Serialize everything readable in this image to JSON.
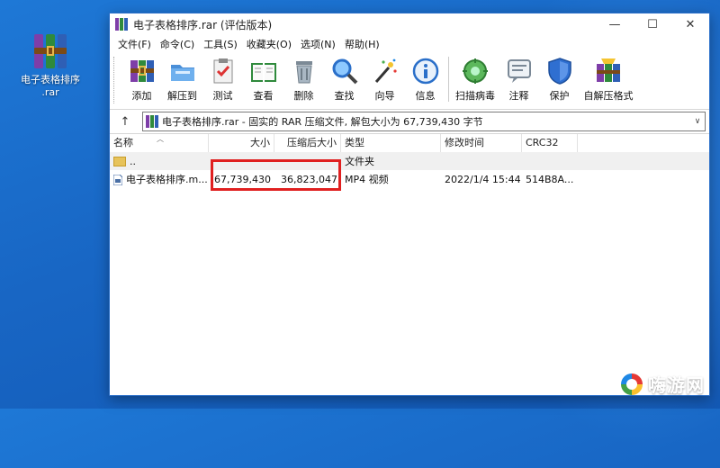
{
  "desktop": {
    "icon_label": "电子表格排序\n.rar"
  },
  "window": {
    "title": "电子表格排序.rar (评估版本)",
    "controls": {
      "minimize": "—",
      "maximize": "☐",
      "close": "✕"
    }
  },
  "menu": [
    "文件(F)",
    "命令(C)",
    "工具(S)",
    "收藏夹(O)",
    "选项(N)",
    "帮助(H)"
  ],
  "toolbar": [
    {
      "label": "添加",
      "icon": "add-books-icon"
    },
    {
      "label": "解压到",
      "icon": "extract-folder-icon"
    },
    {
      "label": "测试",
      "icon": "test-clipboard-icon"
    },
    {
      "label": "查看",
      "icon": "view-book-icon"
    },
    {
      "label": "删除",
      "icon": "trash-icon"
    },
    {
      "label": "查找",
      "icon": "magnifier-icon"
    },
    {
      "label": "向导",
      "icon": "wizard-wand-icon"
    },
    {
      "label": "信息",
      "icon": "info-icon"
    },
    {
      "label": "扫描病毒",
      "icon": "virus-scan-icon"
    },
    {
      "label": "注释",
      "icon": "comment-icon"
    },
    {
      "label": "保护",
      "icon": "shield-icon"
    },
    {
      "label": "自解压格式",
      "icon": "sfx-books-icon"
    }
  ],
  "address": {
    "up": "↑",
    "text": "电子表格排序.rar - 固实的 RAR 压缩文件, 解包大小为 67,739,430 字节"
  },
  "columns": {
    "name": "名称",
    "size": "大小",
    "packed": "压缩后大小",
    "type": "类型",
    "modified": "修改时间",
    "crc": "CRC32"
  },
  "rows": [
    {
      "name": "..",
      "size": "",
      "packed": "",
      "type": "文件夹",
      "modified": "",
      "crc": ""
    },
    {
      "name": "电子表格排序.m...",
      "size": "67,739,430",
      "packed": "36,823,047",
      "type": "MP4 视频",
      "modified": "2022/1/4 15:44",
      "crc": "514B8A..."
    }
  ],
  "watermark": {
    "text": "嗨游网"
  },
  "colors": {
    "highlight": "#e02020",
    "desktop": "#1866c4"
  }
}
